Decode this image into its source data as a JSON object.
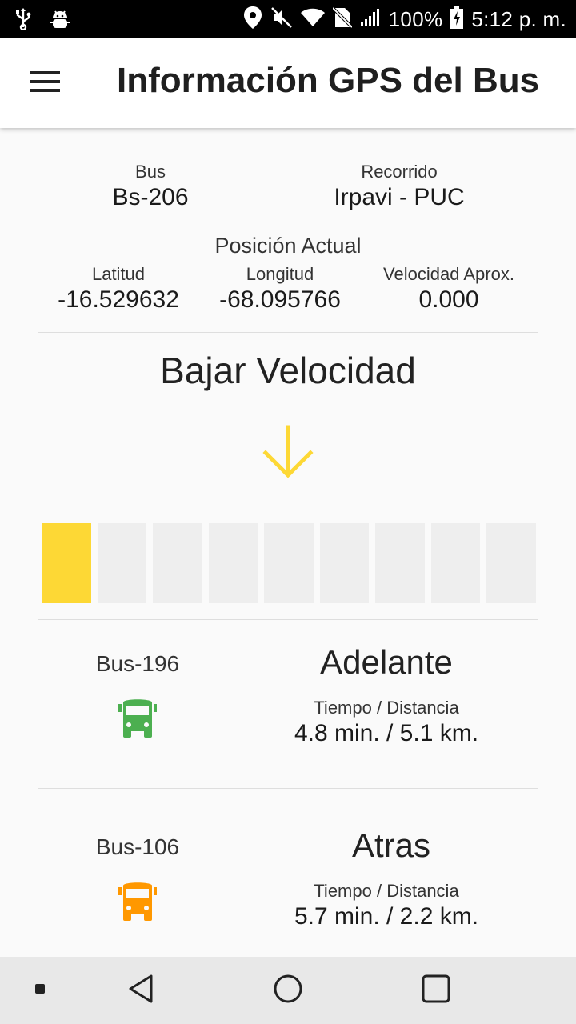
{
  "status_bar": {
    "battery": "100%",
    "time": "5:12 p. m.",
    "icons_left": [
      "usb-icon",
      "android-debug-icon"
    ],
    "icons_right": [
      "location-icon",
      "mute-icon",
      "wifi-icon",
      "no-sim-icon",
      "signal-icon",
      "battery-charging-icon"
    ]
  },
  "app_bar": {
    "title": "Información GPS del Bus",
    "menu_icon": "menu-icon"
  },
  "bus_info": {
    "bus_label": "Bus",
    "bus_value": "Bs-206",
    "route_label": "Recorrido",
    "route_value": "Irpavi - PUC"
  },
  "position": {
    "title": "Posición Actual",
    "lat_label": "Latitud",
    "lat_value": "-16.529632",
    "lon_label": "Longitud",
    "lon_value": "-68.095766",
    "speed_label": "Velocidad Aprox.",
    "speed_value": "0.000"
  },
  "speed_advice": {
    "title": "Bajar Velocidad",
    "icon": "arrow-down-icon",
    "color": "#fdd835",
    "level": 1,
    "segments": 9
  },
  "ahead": {
    "bus": "Bus-196",
    "direction": "Adelante",
    "td_label": "Tiempo / Distancia",
    "td_value": "4.8 min. / 5.1 km.",
    "icon": "bus-icon",
    "color": "#4caf50"
  },
  "behind": {
    "bus": "Bus-106",
    "direction": "Atras",
    "td_label": "Tiempo / Distancia",
    "td_value": "5.7 min. / 2.2 km.",
    "icon": "bus-icon",
    "color": "#ff9800"
  },
  "nav_bar": {
    "buttons": [
      "recents-dot-icon",
      "back-icon",
      "home-icon",
      "overview-icon"
    ]
  }
}
